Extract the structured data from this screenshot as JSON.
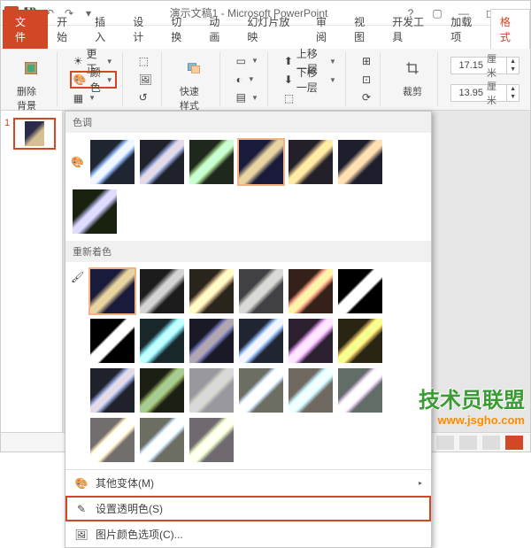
{
  "title": "演示文稿1 - Microsoft PowerPoint",
  "tabs": {
    "file": "文件",
    "items": [
      "开始",
      "插入",
      "设计",
      "切换",
      "动画",
      "幻灯片放映",
      "审阅",
      "视图",
      "开发工具",
      "加载项",
      "格式"
    ],
    "active": "格式"
  },
  "ribbon": {
    "remove_bg": "删除背景",
    "corrections": "更正",
    "color": "颜色",
    "quick_styles": "快速样式",
    "bring_forward": "上移一层",
    "send_backward": "下移一层",
    "crop": "裁剪",
    "height_val": "17.15",
    "width_val": "13.95",
    "unit": "厘米"
  },
  "slide": {
    "num": "1"
  },
  "dropdown": {
    "section1": "色调",
    "section2": "重新着色",
    "more_variants": "其他变体(M)",
    "set_transparent": "设置透明色(S)",
    "color_options": "图片颜色选项(C)..."
  },
  "watermark": {
    "main": "技术员联盟",
    "url": "www.jsgho.com"
  }
}
